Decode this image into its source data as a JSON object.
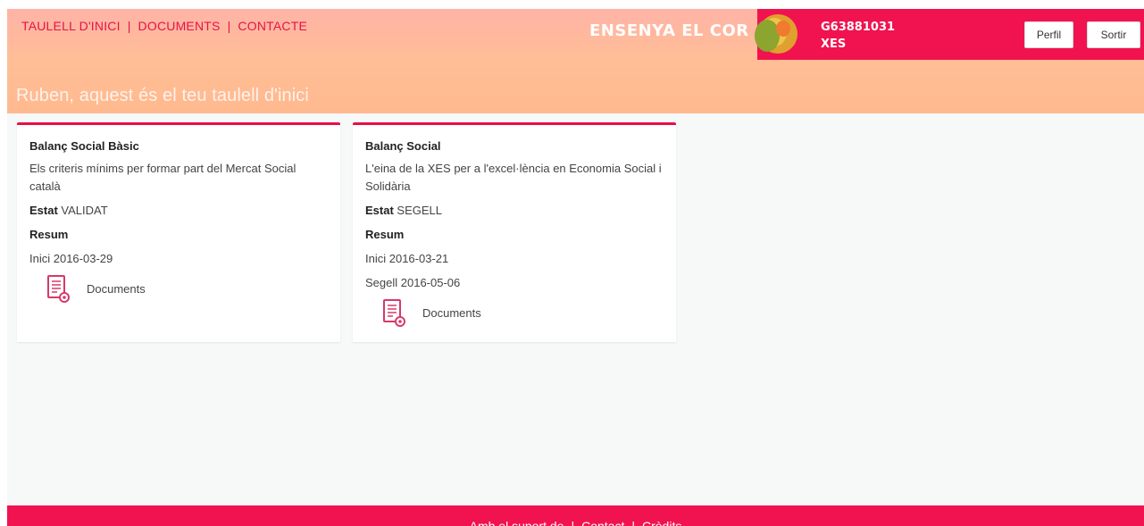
{
  "nav": {
    "items": [
      "TAULELL D'INICI",
      "DOCUMENTS",
      "CONTACTE"
    ],
    "separator": "|"
  },
  "brand": {
    "text_a": "ENSENYA EL",
    "text_b": "COR"
  },
  "user": {
    "id": "G63881031",
    "org": "XES"
  },
  "buttons": {
    "profile": "Perfil",
    "logout": "Sortir"
  },
  "welcome": "Ruben, aquest és el teu taulell d'inici",
  "cards": [
    {
      "title": "Balanç Social Bàsic",
      "description": "Els criteris mínims per formar part del Mercat Social català",
      "status_label": "Estat",
      "status_value": "VALIDAT",
      "summary_label": "Resum",
      "start": "Inici 2016-03-29",
      "docs_label": "Documents"
    },
    {
      "title": "Balanç Social",
      "description": "L'eina de la XES per a l'excel·lència en Economia Social i Solidària",
      "status_label": "Estat",
      "status_value": "SEGELL",
      "summary_label": "Resum",
      "start": "Inici 2016-03-21",
      "seal": "Segell 2016-05-06",
      "docs_label": "Documents"
    }
  ],
  "footer": {
    "items": [
      "Amb el suport de",
      "Contact",
      "Crèdits"
    ],
    "separator": "|"
  },
  "colors": {
    "accent": "#e8104a",
    "header_red": "#f0134f",
    "header_peach": "#ffb98f"
  }
}
